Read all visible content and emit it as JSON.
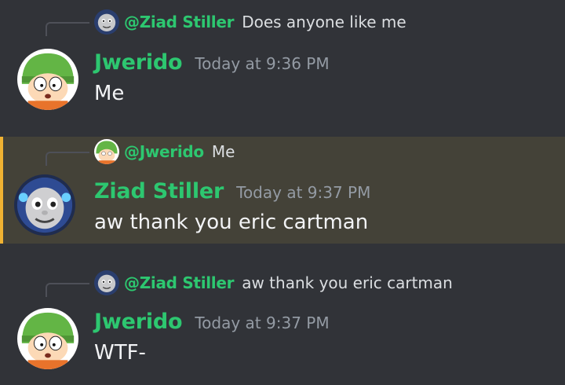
{
  "colors": {
    "background": "#313338",
    "highlight": "#444238",
    "highlight_bar": "#f0b232",
    "username": "#2dc770",
    "timestamp": "#949ba4",
    "text": "#f2f3f5"
  },
  "messages": [
    {
      "reply": {
        "name": "@Ziad Stiller",
        "text": "Does anyone like me",
        "avatar_icon": "thomas-avatar"
      },
      "author": "Jwerido",
      "timestamp": "Today at 9:36 PM",
      "text": "Me",
      "avatar_icon": "kyle-avatar",
      "highlighted": false
    },
    {
      "reply": {
        "name": "@Jwerido",
        "text": "Me",
        "avatar_icon": "kyle-avatar"
      },
      "author": "Ziad Stiller",
      "timestamp": "Today at 9:37 PM",
      "text": "aw thank you eric cartman",
      "avatar_icon": "thomas-avatar",
      "highlighted": true
    },
    {
      "reply": {
        "name": "@Ziad Stiller",
        "text": "aw thank you eric cartman",
        "avatar_icon": "thomas-avatar"
      },
      "author": "Jwerido",
      "timestamp": "Today at 9:37 PM",
      "text": "WTF-",
      "avatar_icon": "kyle-avatar",
      "highlighted": false
    }
  ]
}
